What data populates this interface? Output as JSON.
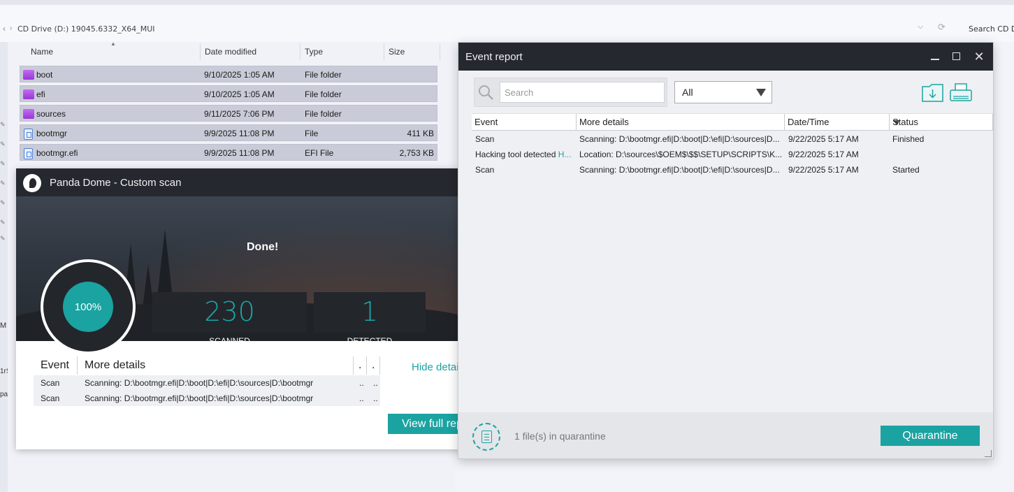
{
  "explorer": {
    "address_path": "CD Drive (D:) 19045.6332_X64_MUI",
    "search_placeholder": "Search CD D",
    "nav_fragments": [
      "M",
      "1rS",
      "pa"
    ],
    "columns": {
      "name": "Name",
      "date_modified": "Date modified",
      "type": "Type",
      "size": "Size"
    },
    "files": [
      {
        "name": "boot",
        "date": "9/10/2025 1:05 AM",
        "type": "File folder",
        "size": "",
        "icon": "folder-icon"
      },
      {
        "name": "efi",
        "date": "9/10/2025 1:05 AM",
        "type": "File folder",
        "size": "",
        "icon": "folder-icon"
      },
      {
        "name": "sources",
        "date": "9/11/2025 7:06 PM",
        "type": "File folder",
        "size": "",
        "icon": "folder-icon"
      },
      {
        "name": "bootmgr",
        "date": "9/9/2025 11:08 PM",
        "type": "File",
        "size": "411 KB",
        "icon": "file-icon"
      },
      {
        "name": "bootmgr.efi",
        "date": "9/9/2025 11:08 PM",
        "type": "EFI File",
        "size": "2,753 KB",
        "icon": "file-icon"
      }
    ]
  },
  "panda": {
    "title": "Panda Dome - Custom scan",
    "status": "Done!",
    "progress_percent": 100,
    "progress_label": "100%",
    "scanned_value": "230",
    "scanned_label": "SCANNED",
    "detected_value": "1",
    "detected_label": "DETECTED",
    "table_headers": {
      "event": "Event",
      "more_details": "More details",
      "col3": ".",
      "col4": "."
    },
    "rows": [
      {
        "event": "Scan",
        "details": "Scanning: D:\\bootmgr.efi|D:\\boot|D:\\efi|D:\\sources|D:\\bootmgr",
        "c3": "..",
        "c4": ".."
      },
      {
        "event": "Scan",
        "details": "Scanning: D:\\bootmgr.efi|D:\\boot|D:\\efi|D:\\sources|D:\\bootmgr",
        "c3": "..",
        "c4": ".."
      }
    ],
    "hide_details_link": "Hide details",
    "view_report_button": "View full report",
    "accent_color": "#1aa3a1"
  },
  "event_report": {
    "title": "Event report",
    "search_placeholder": "Search",
    "filter_value": "All",
    "columns": {
      "event": "Event",
      "more_details": "More details",
      "datetime": "Date/Time",
      "status": "Status"
    },
    "rows": [
      {
        "event": "Scan",
        "event_extra": "",
        "details": "Scanning: D:\\bootmgr.efi|D:\\boot|D:\\efi|D:\\sources|D...",
        "datetime": "9/22/2025 5:17 AM",
        "status": "Finished"
      },
      {
        "event": "Hacking tool detected ",
        "event_extra": "H...",
        "details": "Location: D:\\sources\\$OEM$\\$$\\SETUP\\SCRIPTS\\K...",
        "datetime": "9/22/2025 5:17 AM",
        "status": ""
      },
      {
        "event": "Scan",
        "event_extra": "",
        "details": "Scanning: D:\\bootmgr.efi|D:\\boot|D:\\efi|D:\\sources|D...",
        "datetime": "9/22/2025 5:17 AM",
        "status": "Started"
      }
    ],
    "quarantine_text": "1 file(s) in quarantine",
    "quarantine_button": "Quarantine"
  }
}
